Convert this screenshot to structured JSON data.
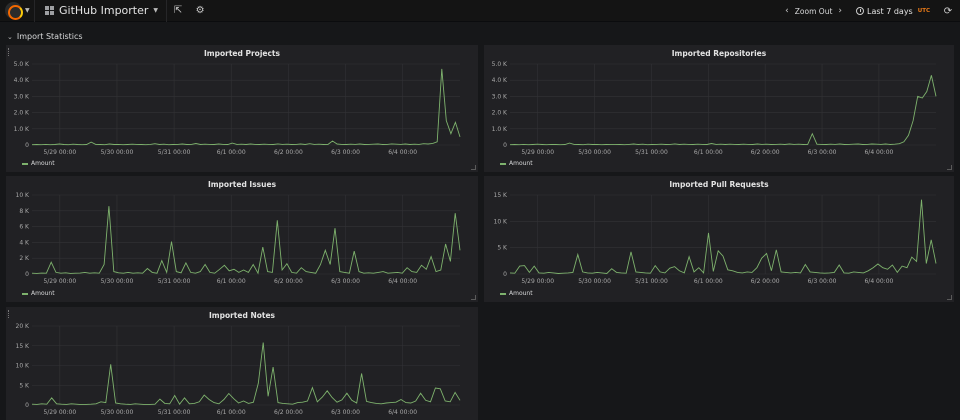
{
  "navbar": {
    "dashboard_title": "GitHub Importer",
    "zoom_out_label": "Zoom Out",
    "time_range_label": "Last 7 days",
    "timezone_badge": "UTC",
    "accent_color": "#eb7b18"
  },
  "row": {
    "title": "Import Statistics"
  },
  "colors": {
    "series": "#7eb26d",
    "panel_bg": "#212124",
    "page_bg": "#161719"
  },
  "chart_data": [
    {
      "type": "line",
      "title": "Imported Projects",
      "x_ticks": [
        "5/29 00:00",
        "5/30 00:00",
        "5/31 00:00",
        "6/1 00:00",
        "6/2 00:00",
        "6/3 00:00",
        "6/4 00:00"
      ],
      "y_ticks": [
        "0",
        "1.0 K",
        "2.0 K",
        "3.0 K",
        "4.0 K",
        "5.0 K"
      ],
      "ylim": [
        0,
        5000
      ],
      "series": [
        {
          "name": "Amount",
          "values": [
            20,
            30,
            20,
            40,
            20,
            30,
            60,
            30,
            20,
            50,
            30,
            20,
            30,
            180,
            40,
            30,
            20,
            60,
            30,
            40,
            20,
            30,
            50,
            40,
            30,
            20,
            40,
            80,
            30,
            50,
            20,
            30,
            40,
            60,
            30,
            40,
            90,
            30,
            50,
            40,
            30,
            60,
            40,
            30,
            120,
            40,
            50,
            30,
            60,
            40,
            30,
            50,
            40,
            30,
            70,
            40,
            50,
            30,
            40,
            60,
            30,
            80,
            40,
            50,
            30,
            40,
            250,
            60,
            40,
            30,
            50,
            40,
            60,
            30,
            40,
            50,
            60,
            30,
            40,
            70,
            50,
            40,
            60,
            30,
            50,
            40,
            80,
            60,
            100,
            200,
            4700,
            1500,
            700,
            1400,
            500
          ]
        }
      ]
    },
    {
      "type": "line",
      "title": "Imported Repositories",
      "x_ticks": [
        "5/29 00:00",
        "5/30 00:00",
        "5/31 00:00",
        "6/1 00:00",
        "6/2 00:00",
        "6/3 00:00",
        "6/4 00:00"
      ],
      "y_ticks": [
        "0",
        "1.0 K",
        "2.0 K",
        "3.0 K",
        "4.0 K",
        "5.0 K"
      ],
      "ylim": [
        0,
        5000
      ],
      "series": [
        {
          "name": "Amount",
          "values": [
            20,
            30,
            20,
            40,
            20,
            30,
            50,
            30,
            20,
            40,
            30,
            20,
            30,
            120,
            40,
            30,
            20,
            50,
            30,
            40,
            20,
            30,
            40,
            40,
            30,
            20,
            40,
            60,
            30,
            50,
            20,
            30,
            40,
            50,
            30,
            40,
            70,
            30,
            50,
            40,
            30,
            50,
            40,
            30,
            90,
            40,
            50,
            30,
            50,
            40,
            30,
            50,
            40,
            30,
            60,
            40,
            50,
            30,
            40,
            50,
            30,
            60,
            40,
            50,
            30,
            40,
            700,
            50,
            40,
            30,
            50,
            40,
            60,
            30,
            40,
            50,
            60,
            30,
            40,
            60,
            50,
            40,
            60,
            30,
            50,
            80,
            200,
            600,
            1500,
            3000,
            2900,
            3300,
            4300,
            3000
          ]
        }
      ]
    },
    {
      "type": "line",
      "title": "Imported Issues",
      "x_ticks": [
        "5/29 00:00",
        "5/30 00:00",
        "5/31 00:00",
        "6/1 00:00",
        "6/2 00:00",
        "6/3 00:00",
        "6/4 00:00"
      ],
      "y_ticks": [
        "0",
        "2 K",
        "4 K",
        "6 K",
        "8 K",
        "10 K"
      ],
      "ylim": [
        0,
        10000
      ],
      "series": [
        {
          "name": "Amount",
          "values": [
            100,
            80,
            120,
            100,
            1500,
            200,
            100,
            150,
            80,
            100,
            120,
            200,
            100,
            150,
            100,
            1200,
            8600,
            300,
            150,
            100,
            200,
            100,
            150,
            100,
            700,
            200,
            100,
            1700,
            200,
            4100,
            300,
            150,
            1400,
            200,
            100,
            300,
            1200,
            200,
            100,
            600,
            1100,
            400,
            600,
            200,
            500,
            200,
            1200,
            100,
            3400,
            300,
            200,
            6800,
            500,
            1300,
            200,
            100,
            800,
            300,
            200,
            100,
            1200,
            3000,
            1200,
            5800,
            300,
            200,
            100,
            2900,
            300,
            100,
            150,
            100,
            200,
            300,
            100,
            150,
            200,
            100,
            800,
            300,
            200,
            1100,
            600,
            2200,
            300,
            500,
            3800,
            1600,
            7700,
            3000
          ]
        }
      ]
    },
    {
      "type": "line",
      "title": "Imported Pull Requests",
      "x_ticks": [
        "5/29 00:00",
        "5/30 00:00",
        "5/31 00:00",
        "6/1 00:00",
        "6/2 00:00",
        "6/3 00:00",
        "6/4 00:00"
      ],
      "y_ticks": [
        "0",
        "5 K",
        "10 K",
        "15 K"
      ],
      "ylim": [
        0,
        15000
      ],
      "series": [
        {
          "name": "Amount",
          "values": [
            200,
            150,
            1500,
            1600,
            300,
            1500,
            200,
            150,
            300,
            200,
            100,
            150,
            200,
            300,
            3700,
            400,
            200,
            150,
            300,
            200,
            100,
            1000,
            300,
            200,
            150,
            4200,
            400,
            300,
            200,
            150,
            1600,
            400,
            200,
            1100,
            1400,
            600,
            200,
            3300,
            400,
            1200,
            200,
            7800,
            500,
            4400,
            3400,
            800,
            600,
            300,
            200,
            400,
            300,
            1200,
            3000,
            3900,
            600,
            4600,
            400,
            300,
            200,
            300,
            200,
            1800,
            400,
            300,
            200,
            150,
            200,
            300,
            1700,
            200,
            150,
            400,
            300,
            200,
            600,
            1200,
            1900,
            1200,
            900,
            1700,
            300,
            1500,
            1200,
            3200,
            2400,
            14100,
            2000,
            6500,
            2000
          ]
        }
      ]
    },
    {
      "type": "line",
      "title": "Imported Notes",
      "x_ticks": [
        "5/29 00:00",
        "5/30 00:00",
        "5/31 00:00",
        "6/1 00:00",
        "6/2 00:00",
        "6/3 00:00",
        "6/4 00:00"
      ],
      "y_ticks": [
        "0",
        "5 K",
        "10 K",
        "15 K",
        "20 K"
      ],
      "ylim": [
        0,
        20000
      ],
      "series": [
        {
          "name": "Amount",
          "values": [
            200,
            150,
            300,
            200,
            1800,
            300,
            200,
            150,
            300,
            200,
            100,
            150,
            200,
            300,
            800,
            600,
            10300,
            500,
            300,
            200,
            150,
            300,
            200,
            100,
            150,
            200,
            1500,
            400,
            300,
            2400,
            200,
            1800,
            300,
            400,
            800,
            2500,
            1400,
            600,
            300,
            1400,
            2900,
            1600,
            500,
            1000,
            400,
            700,
            5500,
            15800,
            2200,
            9600,
            600,
            400,
            300,
            200,
            600,
            700,
            1000,
            4400,
            800,
            2000,
            3600,
            1900,
            700,
            1300,
            3000,
            1200,
            500,
            8000,
            900,
            600,
            400,
            300,
            500,
            600,
            700,
            1400,
            600,
            500,
            1000,
            3000,
            1200,
            800,
            4300,
            4100,
            1000,
            800,
            3200,
            1200
          ]
        }
      ]
    }
  ]
}
